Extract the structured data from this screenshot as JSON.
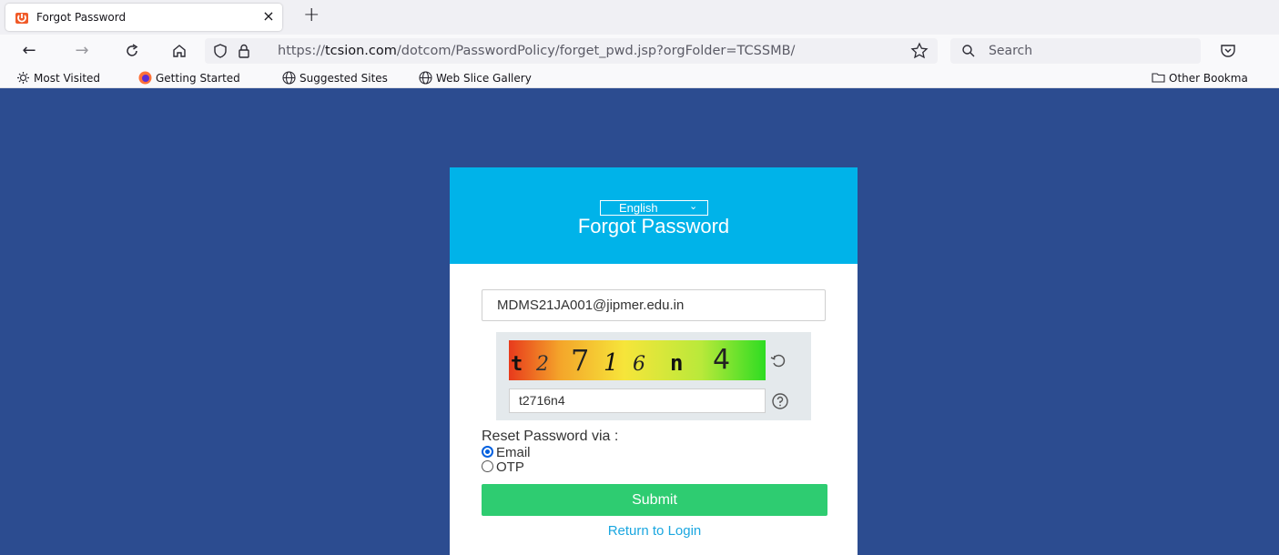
{
  "browser": {
    "tab_title": "Forgot Password",
    "url_prefix": "https://",
    "url_domain": "tcsion.com",
    "url_path": "/dotcom/PasswordPolicy/forget_pwd.jsp?orgFolder=TCSSMB/",
    "search_placeholder": "Search",
    "bookmarks": [
      "Most Visited",
      "Getting Started",
      "Suggested Sites",
      "Web Slice Gallery"
    ],
    "other_bookmarks": "Other Bookma"
  },
  "page": {
    "language": "English",
    "title": "Forgot Password",
    "email_value": "MDMS21JA001@jipmer.edu.in",
    "captcha_chars": [
      "t",
      "2",
      "7",
      "1",
      "6",
      "n",
      "4"
    ],
    "captcha_input_value": "t2716n4",
    "reset_label": "Reset Password via :",
    "option_email": "Email",
    "option_otp": "OTP",
    "submit_label": "Submit",
    "return_link": "Return to Login"
  }
}
